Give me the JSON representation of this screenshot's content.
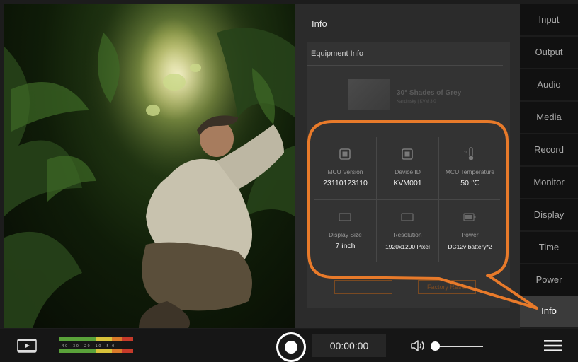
{
  "panel": {
    "title": "Info"
  },
  "equipment": {
    "title": "Equipment Info",
    "device_name": "30° Shades of Grey",
    "device_sub": "Kandinsky | KVM 3.0",
    "cells": [
      {
        "label": "MCU Version",
        "value": "23110123110",
        "icon": "chip-icon"
      },
      {
        "label": "Device ID",
        "value": "KVM001",
        "icon": "chip-icon"
      },
      {
        "label": "MCU Temperature",
        "value": "50 ℃",
        "icon": "thermometer-icon"
      },
      {
        "label": "Display Size",
        "value": "7 inch",
        "icon": "display-icon"
      },
      {
        "label": "Resolution",
        "value": "1920x1200 Pixel",
        "icon": "display-icon"
      },
      {
        "label": "Power",
        "value": "DC12v battery*2",
        "icon": "battery-icon"
      }
    ],
    "buttons": {
      "left": "",
      "right": "Factory Reset"
    }
  },
  "menu": {
    "items": [
      "Input",
      "Output",
      "Audio",
      "Media",
      "Record",
      "Monitor",
      "Display",
      "Time",
      "Power",
      "Info"
    ],
    "active": "Info"
  },
  "bottom": {
    "timecode": "00:00:00",
    "meter_scale": "-40 -30 -20 -10 -5 0"
  },
  "colors": {
    "highlight": "#e87a2a",
    "panel_bg": "#2b2b2b",
    "menu_active_bg": "#3b3b3b",
    "menu_bg": "#111111"
  }
}
